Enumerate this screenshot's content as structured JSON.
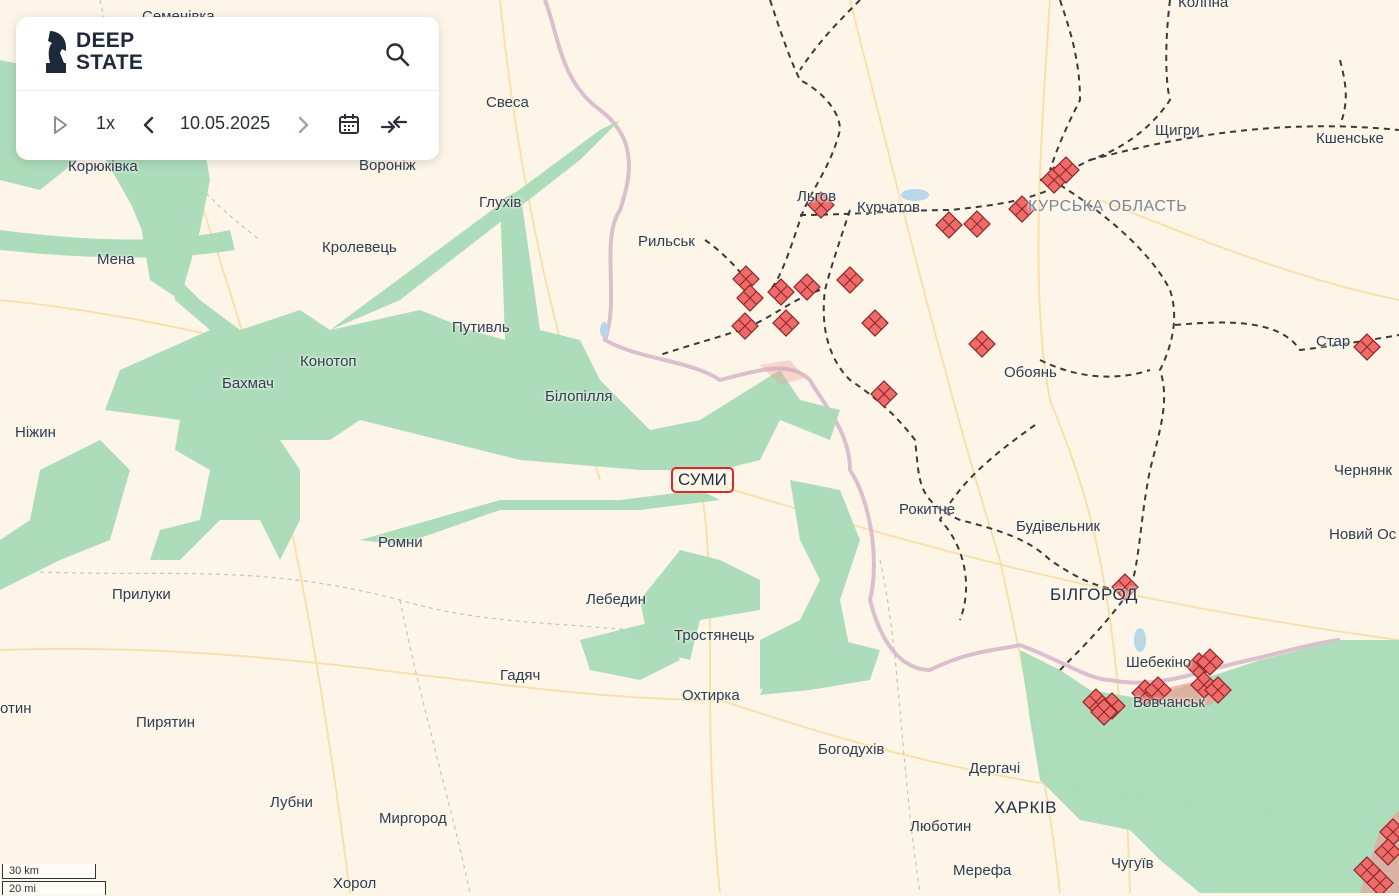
{
  "app": {
    "logo_line1": "DEEP",
    "logo_line2": "STATE"
  },
  "controls": {
    "play_icon": "play-icon",
    "speed": "1x",
    "date": "10.05.2025",
    "prev_icon": "chevron-left-icon",
    "next_icon": "chevron-right-icon",
    "calendar_icon": "calendar-icon",
    "compare_icon": "compare-arrows-icon",
    "search_icon": "search-icon"
  },
  "map": {
    "selected_city": "СУМИ",
    "cities": {
      "semenivka": "Семенівка",
      "svesa": "Свеса",
      "koriukivka": "Корюківка",
      "voronizh": "Вороніж",
      "hlukhiv": "Глухів",
      "mena": "Мена",
      "krolevets": "Кролевець",
      "putyvl": "Путивль",
      "konotop": "Конотоп",
      "bakhmach": "Бахмач",
      "bilopillia": "Білопілля",
      "nizhyn": "Ніжин",
      "romny": "Ромни",
      "pryluky": "Прилуки",
      "lebedyn": "Лебедин",
      "trostianets": "Тростянець",
      "hadiach": "Гадяч",
      "okhtyrka": "Охтирка",
      "otyn": "отин",
      "pyriatyn": "Пирятин",
      "bohodukhiv": "Богодухів",
      "lubny": "Лубни",
      "myrhorod": "Миргород",
      "khorol": "Хорол",
      "dergachi": "Дергачі",
      "liubotyn": "Люботин",
      "merefa": "Мерефа",
      "chuhuiv": "Чугуїв",
      "kolpna": "Колпна",
      "shchyhry": "Щигри",
      "kshenske": "Кшенське",
      "lgov": "Льгов",
      "kurchatov": "Курчатов",
      "rylsk": "Рильськ",
      "oboian": "Обоянь",
      "rokytne": "Рокитне",
      "budivelnyk": "Будівельник",
      "shebekino": "Шебекіно",
      "vovchansk": "Вовчанськ",
      "chernianka": "Чернянк",
      "novyi_oskol": "Новий Ос",
      "staryi_oskol": "Стар"
    },
    "big_cities": {
      "bilhorod": "БІЛГОРОД",
      "kharkiv": "ХАРКІВ"
    },
    "regions": {
      "kursk_oblast": "КУРСЬКА ОБЛАСТЬ"
    },
    "colors": {
      "background": "#fdf6e8",
      "ukraine_controlled_green": "#a9dbb8",
      "occupied_red": "#e8a39b",
      "attack_marker": "#ee6b6b",
      "border": "#d7b9cb",
      "railway": "#3a3a3a"
    }
  },
  "scale": {
    "km": "30 km",
    "mi": "20 mi"
  }
}
